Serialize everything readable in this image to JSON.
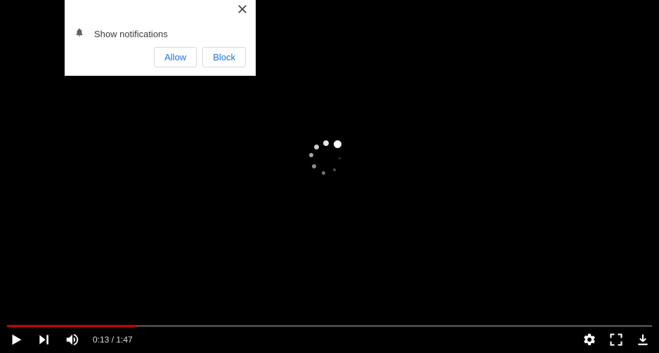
{
  "notification": {
    "message": "Show notifications",
    "allow_label": "Allow",
    "block_label": "Block"
  },
  "player": {
    "current_time": "0:13",
    "duration": "1:47",
    "time_separator": " / ",
    "progress_percent": 20,
    "state": "loading"
  },
  "colors": {
    "progress_played": "#cc0000",
    "link": "#1a73e8"
  },
  "icons": {
    "close": "close-icon",
    "bell": "bell-icon",
    "play": "play-icon",
    "next": "next-icon",
    "volume": "volume-icon",
    "settings": "gear-icon",
    "fullscreen": "fullscreen-icon",
    "download": "download-icon"
  }
}
